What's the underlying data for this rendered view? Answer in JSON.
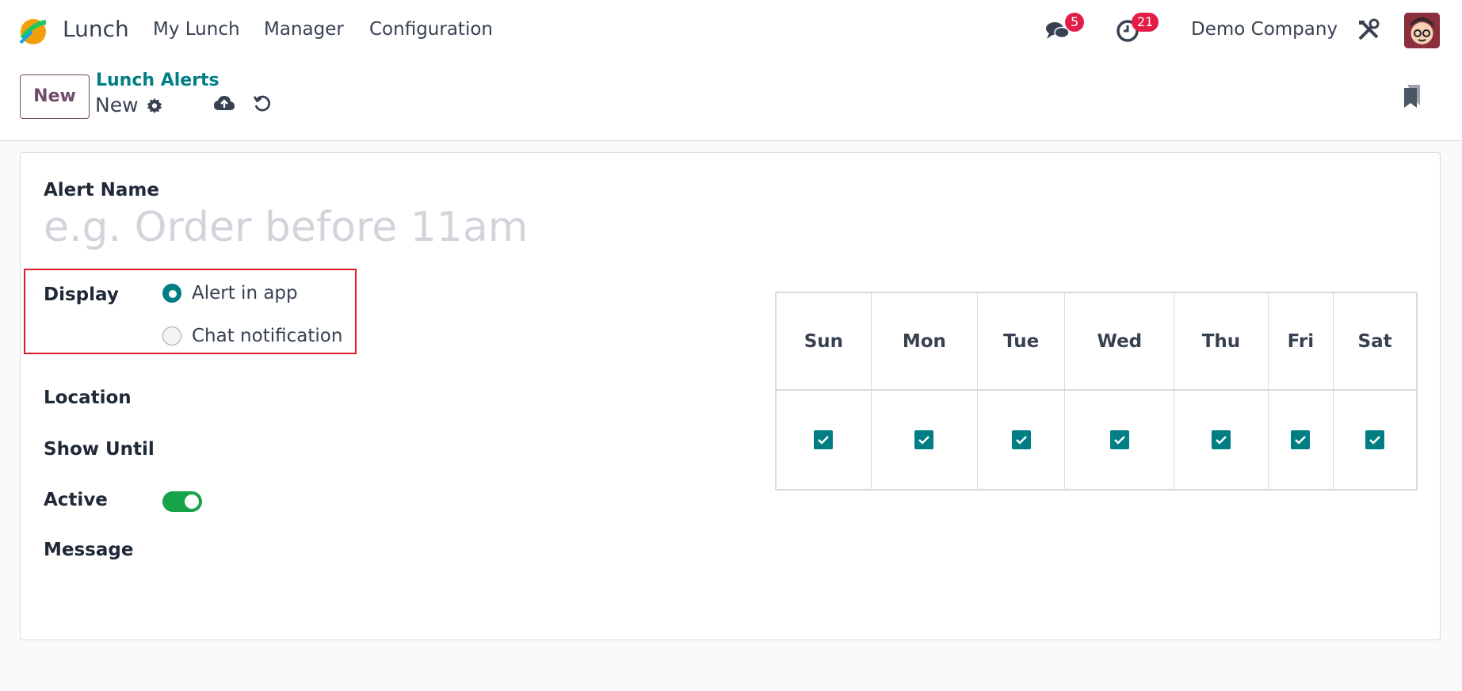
{
  "app": {
    "name": "Lunch"
  },
  "nav": {
    "menu": [
      "My Lunch",
      "Manager",
      "Configuration"
    ]
  },
  "systray": {
    "messages_count": "5",
    "activities_count": "21",
    "company": "Demo Company"
  },
  "control": {
    "new_label": "New",
    "breadcrumb_parent": "Lunch Alerts",
    "record_title": "New"
  },
  "form": {
    "alert_name_label": "Alert Name",
    "alert_name_placeholder": "e.g. Order before 11am",
    "alert_name_value": "",
    "display_label": "Display",
    "display_options": [
      "Alert in app",
      "Chat notification"
    ],
    "display_selected": "Alert in app",
    "location_label": "Location",
    "show_until_label": "Show Until",
    "active_label": "Active",
    "active": true,
    "message_label": "Message"
  },
  "days": {
    "headers": [
      "Sun",
      "Mon",
      "Tue",
      "Wed",
      "Thu",
      "Fri",
      "Sat"
    ],
    "checked": [
      true,
      true,
      true,
      true,
      true,
      true,
      true
    ]
  },
  "colors": {
    "primary": "#714b67",
    "teal": "#017e84",
    "badge": "#e11d48",
    "toggle_on": "#16a34a",
    "highlight": "#e01b24"
  }
}
